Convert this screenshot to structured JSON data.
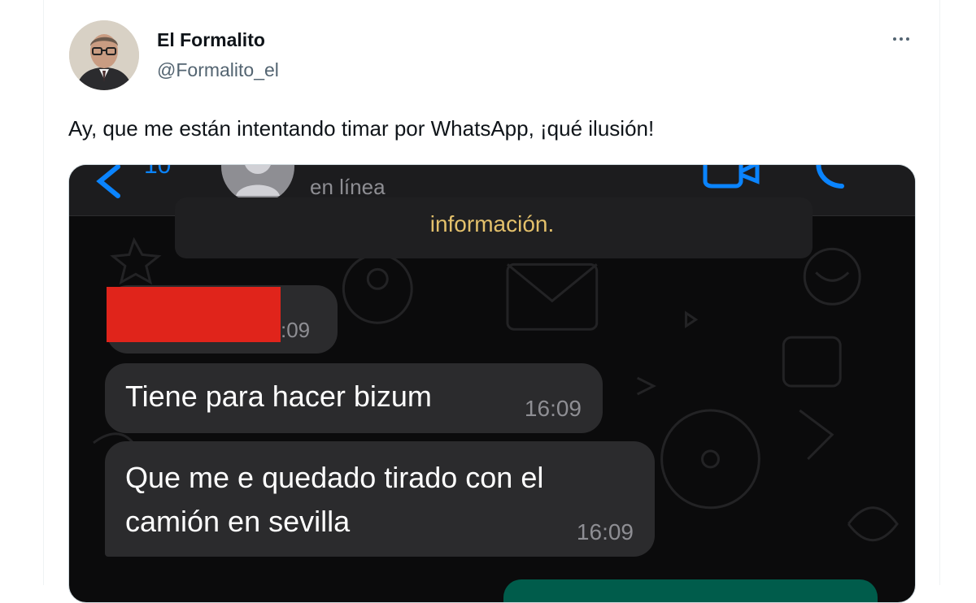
{
  "tweet": {
    "author_name": "El Formalito",
    "handle": "@Formalito_el",
    "text": "Ay, que me están intentando timar por WhatsApp, ¡qué ilusión!",
    "more_icon": "more-horizontal-icon"
  },
  "whatsapp": {
    "header": {
      "back_count": "10",
      "status": "en línea",
      "icons": [
        "back-chevron-icon",
        "contact-avatar-icon",
        "video-call-icon",
        "phone-call-icon"
      ]
    },
    "system_message": "información.",
    "messages": [
      {
        "text": "",
        "time": ":09",
        "redacted": true
      },
      {
        "text": "Tiene para hacer bizum",
        "time": "16:09"
      },
      {
        "text_lines": [
          "Que me e quedado tirado con el",
          "camión en sevilla"
        ],
        "time": "16:09"
      }
    ],
    "colors": {
      "accent_blue": "#0a84ff",
      "system_text": "#e3c06b",
      "bubble": "#2b2b2d",
      "outgoing_bubble": "#005c4b",
      "redaction": "#e0241b"
    }
  }
}
